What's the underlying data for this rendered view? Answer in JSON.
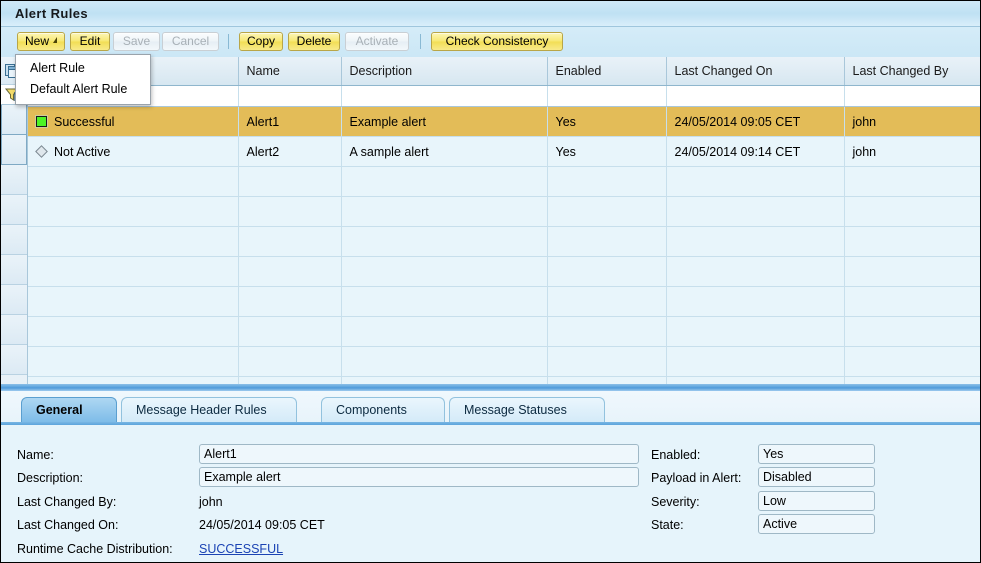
{
  "window": {
    "title": "Alert Rules"
  },
  "toolbar": {
    "buttons": [
      {
        "label": "New",
        "enabled": true,
        "has_caret": true
      },
      {
        "label": "Edit",
        "enabled": true,
        "has_caret": false
      },
      {
        "label": "Save",
        "enabled": false,
        "has_caret": false
      },
      {
        "label": "Cancel",
        "enabled": false,
        "has_caret": false
      },
      {
        "label": "Copy",
        "enabled": true,
        "has_caret": false
      },
      {
        "label": "Delete",
        "enabled": true,
        "has_caret": false
      },
      {
        "label": "Activate",
        "enabled": false,
        "has_caret": false
      },
      {
        "label": "Check Consistency",
        "enabled": true,
        "has_caret": false
      }
    ]
  },
  "new_menu": {
    "open": true,
    "items": [
      {
        "label": "Alert Rule"
      },
      {
        "label": "Default Alert Rule"
      }
    ]
  },
  "gutter": {
    "settings_icon": "table-settings-icon",
    "filter_icon": "filter-icon"
  },
  "table": {
    "columns": [
      {
        "label": ""
      },
      {
        "label": "Name"
      },
      {
        "label": "Description"
      },
      {
        "label": "Enabled"
      },
      {
        "label": "Last Changed On"
      },
      {
        "label": "Last Changed By"
      }
    ],
    "rows": [
      {
        "selected": true,
        "status_icon": "green-square-icon",
        "status": "Successful",
        "name": "Alert1",
        "description": "Example alert",
        "enabled": "Yes",
        "last_changed_on": "24/05/2014 09:05 CET",
        "last_changed_by": "john"
      },
      {
        "selected": false,
        "status_icon": "gray-diamond-icon",
        "status": "Not Active",
        "name": "Alert2",
        "description": "A sample alert",
        "enabled": "Yes",
        "last_changed_on": "24/05/2014 09:14 CET",
        "last_changed_by": "john"
      }
    ],
    "empty_row_count": 8
  },
  "tabs": [
    {
      "label": "General",
      "active": true
    },
    {
      "label": "Message Header Rules",
      "active": false
    },
    {
      "label": "Components",
      "active": false
    },
    {
      "label": "Message Statuses",
      "active": false
    }
  ],
  "detail": {
    "left": {
      "name_label": "Name:",
      "name_value": "Alert1",
      "description_label": "Description:",
      "description_value": "Example alert",
      "last_changed_by_label": "Last Changed By:",
      "last_changed_by_value": "john",
      "last_changed_on_label": "Last Changed On:",
      "last_changed_on_value": "24/05/2014 09:05 CET",
      "runtime_cache_label": "Runtime Cache Distribution:",
      "runtime_cache_value": "SUCCESSFUL"
    },
    "right": {
      "enabled_label": "Enabled:",
      "enabled_value": "Yes",
      "payload_label": "Payload in Alert:",
      "payload_value": "Disabled",
      "severity_label": "Severity:",
      "severity_value": "Low",
      "state_label": "State:",
      "state_value": "Active"
    }
  },
  "colors": {
    "selection": "#e3bc58",
    "button": "#f2de55",
    "accent": "#5aa3dd",
    "link": "#1b43b4",
    "status_ok": "#4df425"
  }
}
